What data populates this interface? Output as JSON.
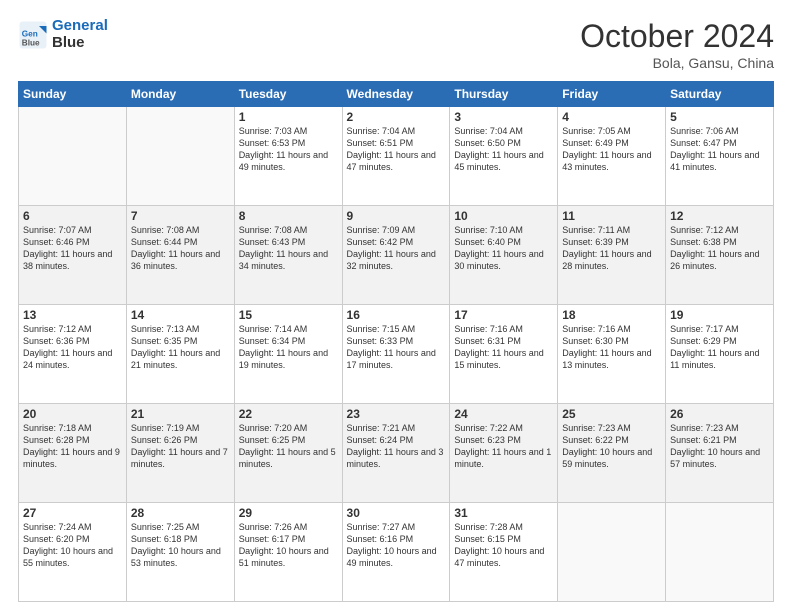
{
  "logo": {
    "line1": "General",
    "line2": "Blue"
  },
  "title": "October 2024",
  "location": "Bola, Gansu, China",
  "weekdays": [
    "Sunday",
    "Monday",
    "Tuesday",
    "Wednesday",
    "Thursday",
    "Friday",
    "Saturday"
  ],
  "rows": [
    [
      null,
      null,
      {
        "day": "1",
        "sunrise": "Sunrise: 7:03 AM",
        "sunset": "Sunset: 6:53 PM",
        "daylight": "Daylight: 11 hours and 49 minutes."
      },
      {
        "day": "2",
        "sunrise": "Sunrise: 7:04 AM",
        "sunset": "Sunset: 6:51 PM",
        "daylight": "Daylight: 11 hours and 47 minutes."
      },
      {
        "day": "3",
        "sunrise": "Sunrise: 7:04 AM",
        "sunset": "Sunset: 6:50 PM",
        "daylight": "Daylight: 11 hours and 45 minutes."
      },
      {
        "day": "4",
        "sunrise": "Sunrise: 7:05 AM",
        "sunset": "Sunset: 6:49 PM",
        "daylight": "Daylight: 11 hours and 43 minutes."
      },
      {
        "day": "5",
        "sunrise": "Sunrise: 7:06 AM",
        "sunset": "Sunset: 6:47 PM",
        "daylight": "Daylight: 11 hours and 41 minutes."
      }
    ],
    [
      {
        "day": "6",
        "sunrise": "Sunrise: 7:07 AM",
        "sunset": "Sunset: 6:46 PM",
        "daylight": "Daylight: 11 hours and 38 minutes."
      },
      {
        "day": "7",
        "sunrise": "Sunrise: 7:08 AM",
        "sunset": "Sunset: 6:44 PM",
        "daylight": "Daylight: 11 hours and 36 minutes."
      },
      {
        "day": "8",
        "sunrise": "Sunrise: 7:08 AM",
        "sunset": "Sunset: 6:43 PM",
        "daylight": "Daylight: 11 hours and 34 minutes."
      },
      {
        "day": "9",
        "sunrise": "Sunrise: 7:09 AM",
        "sunset": "Sunset: 6:42 PM",
        "daylight": "Daylight: 11 hours and 32 minutes."
      },
      {
        "day": "10",
        "sunrise": "Sunrise: 7:10 AM",
        "sunset": "Sunset: 6:40 PM",
        "daylight": "Daylight: 11 hours and 30 minutes."
      },
      {
        "day": "11",
        "sunrise": "Sunrise: 7:11 AM",
        "sunset": "Sunset: 6:39 PM",
        "daylight": "Daylight: 11 hours and 28 minutes."
      },
      {
        "day": "12",
        "sunrise": "Sunrise: 7:12 AM",
        "sunset": "Sunset: 6:38 PM",
        "daylight": "Daylight: 11 hours and 26 minutes."
      }
    ],
    [
      {
        "day": "13",
        "sunrise": "Sunrise: 7:12 AM",
        "sunset": "Sunset: 6:36 PM",
        "daylight": "Daylight: 11 hours and 24 minutes."
      },
      {
        "day": "14",
        "sunrise": "Sunrise: 7:13 AM",
        "sunset": "Sunset: 6:35 PM",
        "daylight": "Daylight: 11 hours and 21 minutes."
      },
      {
        "day": "15",
        "sunrise": "Sunrise: 7:14 AM",
        "sunset": "Sunset: 6:34 PM",
        "daylight": "Daylight: 11 hours and 19 minutes."
      },
      {
        "day": "16",
        "sunrise": "Sunrise: 7:15 AM",
        "sunset": "Sunset: 6:33 PM",
        "daylight": "Daylight: 11 hours and 17 minutes."
      },
      {
        "day": "17",
        "sunrise": "Sunrise: 7:16 AM",
        "sunset": "Sunset: 6:31 PM",
        "daylight": "Daylight: 11 hours and 15 minutes."
      },
      {
        "day": "18",
        "sunrise": "Sunrise: 7:16 AM",
        "sunset": "Sunset: 6:30 PM",
        "daylight": "Daylight: 11 hours and 13 minutes."
      },
      {
        "day": "19",
        "sunrise": "Sunrise: 7:17 AM",
        "sunset": "Sunset: 6:29 PM",
        "daylight": "Daylight: 11 hours and 11 minutes."
      }
    ],
    [
      {
        "day": "20",
        "sunrise": "Sunrise: 7:18 AM",
        "sunset": "Sunset: 6:28 PM",
        "daylight": "Daylight: 11 hours and 9 minutes."
      },
      {
        "day": "21",
        "sunrise": "Sunrise: 7:19 AM",
        "sunset": "Sunset: 6:26 PM",
        "daylight": "Daylight: 11 hours and 7 minutes."
      },
      {
        "day": "22",
        "sunrise": "Sunrise: 7:20 AM",
        "sunset": "Sunset: 6:25 PM",
        "daylight": "Daylight: 11 hours and 5 minutes."
      },
      {
        "day": "23",
        "sunrise": "Sunrise: 7:21 AM",
        "sunset": "Sunset: 6:24 PM",
        "daylight": "Daylight: 11 hours and 3 minutes."
      },
      {
        "day": "24",
        "sunrise": "Sunrise: 7:22 AM",
        "sunset": "Sunset: 6:23 PM",
        "daylight": "Daylight: 11 hours and 1 minute."
      },
      {
        "day": "25",
        "sunrise": "Sunrise: 7:23 AM",
        "sunset": "Sunset: 6:22 PM",
        "daylight": "Daylight: 10 hours and 59 minutes."
      },
      {
        "day": "26",
        "sunrise": "Sunrise: 7:23 AM",
        "sunset": "Sunset: 6:21 PM",
        "daylight": "Daylight: 10 hours and 57 minutes."
      }
    ],
    [
      {
        "day": "27",
        "sunrise": "Sunrise: 7:24 AM",
        "sunset": "Sunset: 6:20 PM",
        "daylight": "Daylight: 10 hours and 55 minutes."
      },
      {
        "day": "28",
        "sunrise": "Sunrise: 7:25 AM",
        "sunset": "Sunset: 6:18 PM",
        "daylight": "Daylight: 10 hours and 53 minutes."
      },
      {
        "day": "29",
        "sunrise": "Sunrise: 7:26 AM",
        "sunset": "Sunset: 6:17 PM",
        "daylight": "Daylight: 10 hours and 51 minutes."
      },
      {
        "day": "30",
        "sunrise": "Sunrise: 7:27 AM",
        "sunset": "Sunset: 6:16 PM",
        "daylight": "Daylight: 10 hours and 49 minutes."
      },
      {
        "day": "31",
        "sunrise": "Sunrise: 7:28 AM",
        "sunset": "Sunset: 6:15 PM",
        "daylight": "Daylight: 10 hours and 47 minutes."
      },
      null,
      null
    ]
  ]
}
